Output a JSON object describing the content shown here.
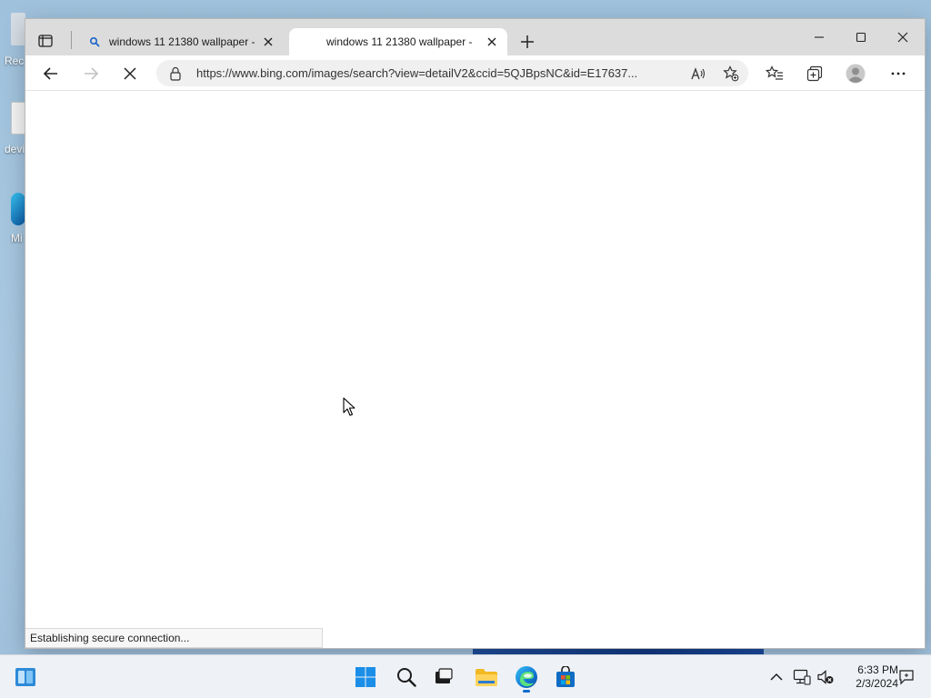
{
  "desktop": {
    "icons": [
      {
        "label": "Rec"
      },
      {
        "label": "devi"
      },
      {
        "label": "Mi"
      }
    ]
  },
  "browser": {
    "tabs": [
      {
        "title": "windows 11 21380 wallpaper -",
        "icon": "bing-search-icon",
        "state": "inactive"
      },
      {
        "title": "windows 11 21380 wallpaper -",
        "icon": "loading-icon",
        "state": "active"
      }
    ],
    "address": {
      "url": "https://www.bing.com/images/search?view=detailV2&ccid=5QJBpsNC&id=E17637..."
    },
    "status_text": "Establishing secure connection...",
    "accent": "#0a6bd0"
  },
  "taskbar": {
    "apps": [
      "widgets-icon",
      "start-icon",
      "search-icon",
      "task-view-icon",
      "file-explorer-icon",
      "edge-icon",
      "store-icon"
    ],
    "clock": {
      "time": "6:33 PM",
      "date": "2/3/2024"
    }
  }
}
